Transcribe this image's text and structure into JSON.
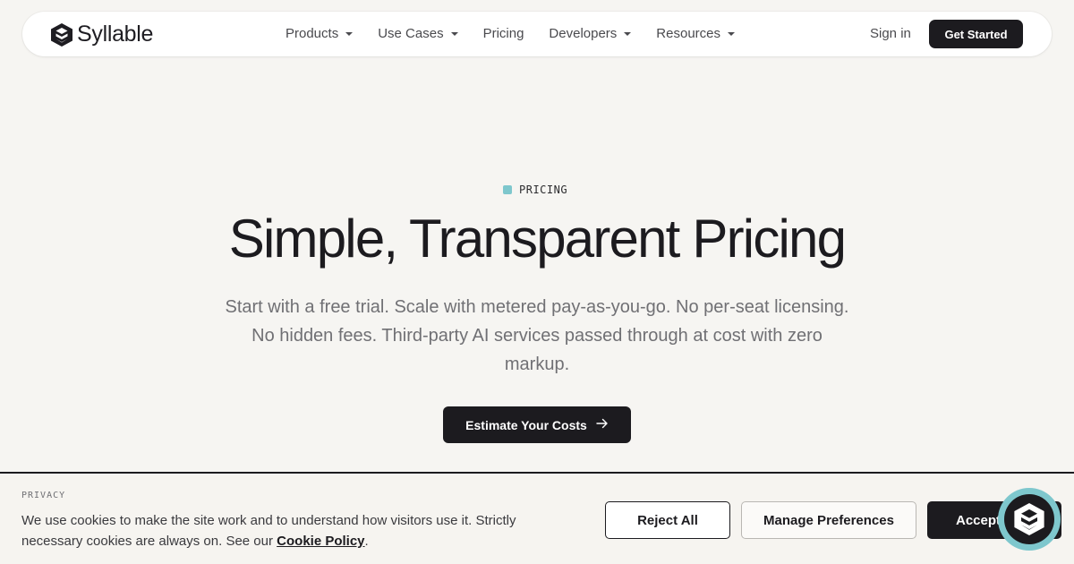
{
  "nav": {
    "brand": "Syllable",
    "brand_icon": "syllable-logo-icon",
    "menu": [
      {
        "label": "Products",
        "has_dropdown": true
      },
      {
        "label": "Use Cases",
        "has_dropdown": true
      },
      {
        "label": "Pricing",
        "has_dropdown": false
      },
      {
        "label": "Developers",
        "has_dropdown": true
      },
      {
        "label": "Resources",
        "has_dropdown": true
      }
    ],
    "sign_in": "Sign in",
    "get_started": "Get Started"
  },
  "hero": {
    "eyebrow": "PRICING",
    "headline": "Simple, Transparent Pricing",
    "subtext": "Start with a free trial. Scale with metered pay-as-you-go. No per-seat licensing. No hidden fees. Third-party AI services passed through at cost with zero markup.",
    "cta_label": "Estimate Your Costs",
    "cta_icon": "arrow-right-icon"
  },
  "cookie_banner": {
    "label": "PRIVACY",
    "text": "We use cookies to make the site work and to understand how visitors use it. Strictly necessary cookies are always on. See our ",
    "link_text": "Cookie Policy",
    "text_end": ".",
    "reject_label": "Reject All",
    "manage_label": "Manage Preferences",
    "accept_label": "Accept All"
  },
  "chat_widget": {
    "icon": "syllable-chat-icon"
  },
  "colors": {
    "background": "#f6f5f2",
    "dark": "#1c1b1f",
    "accent": "#7ec7cd",
    "muted_text": "#707074"
  }
}
